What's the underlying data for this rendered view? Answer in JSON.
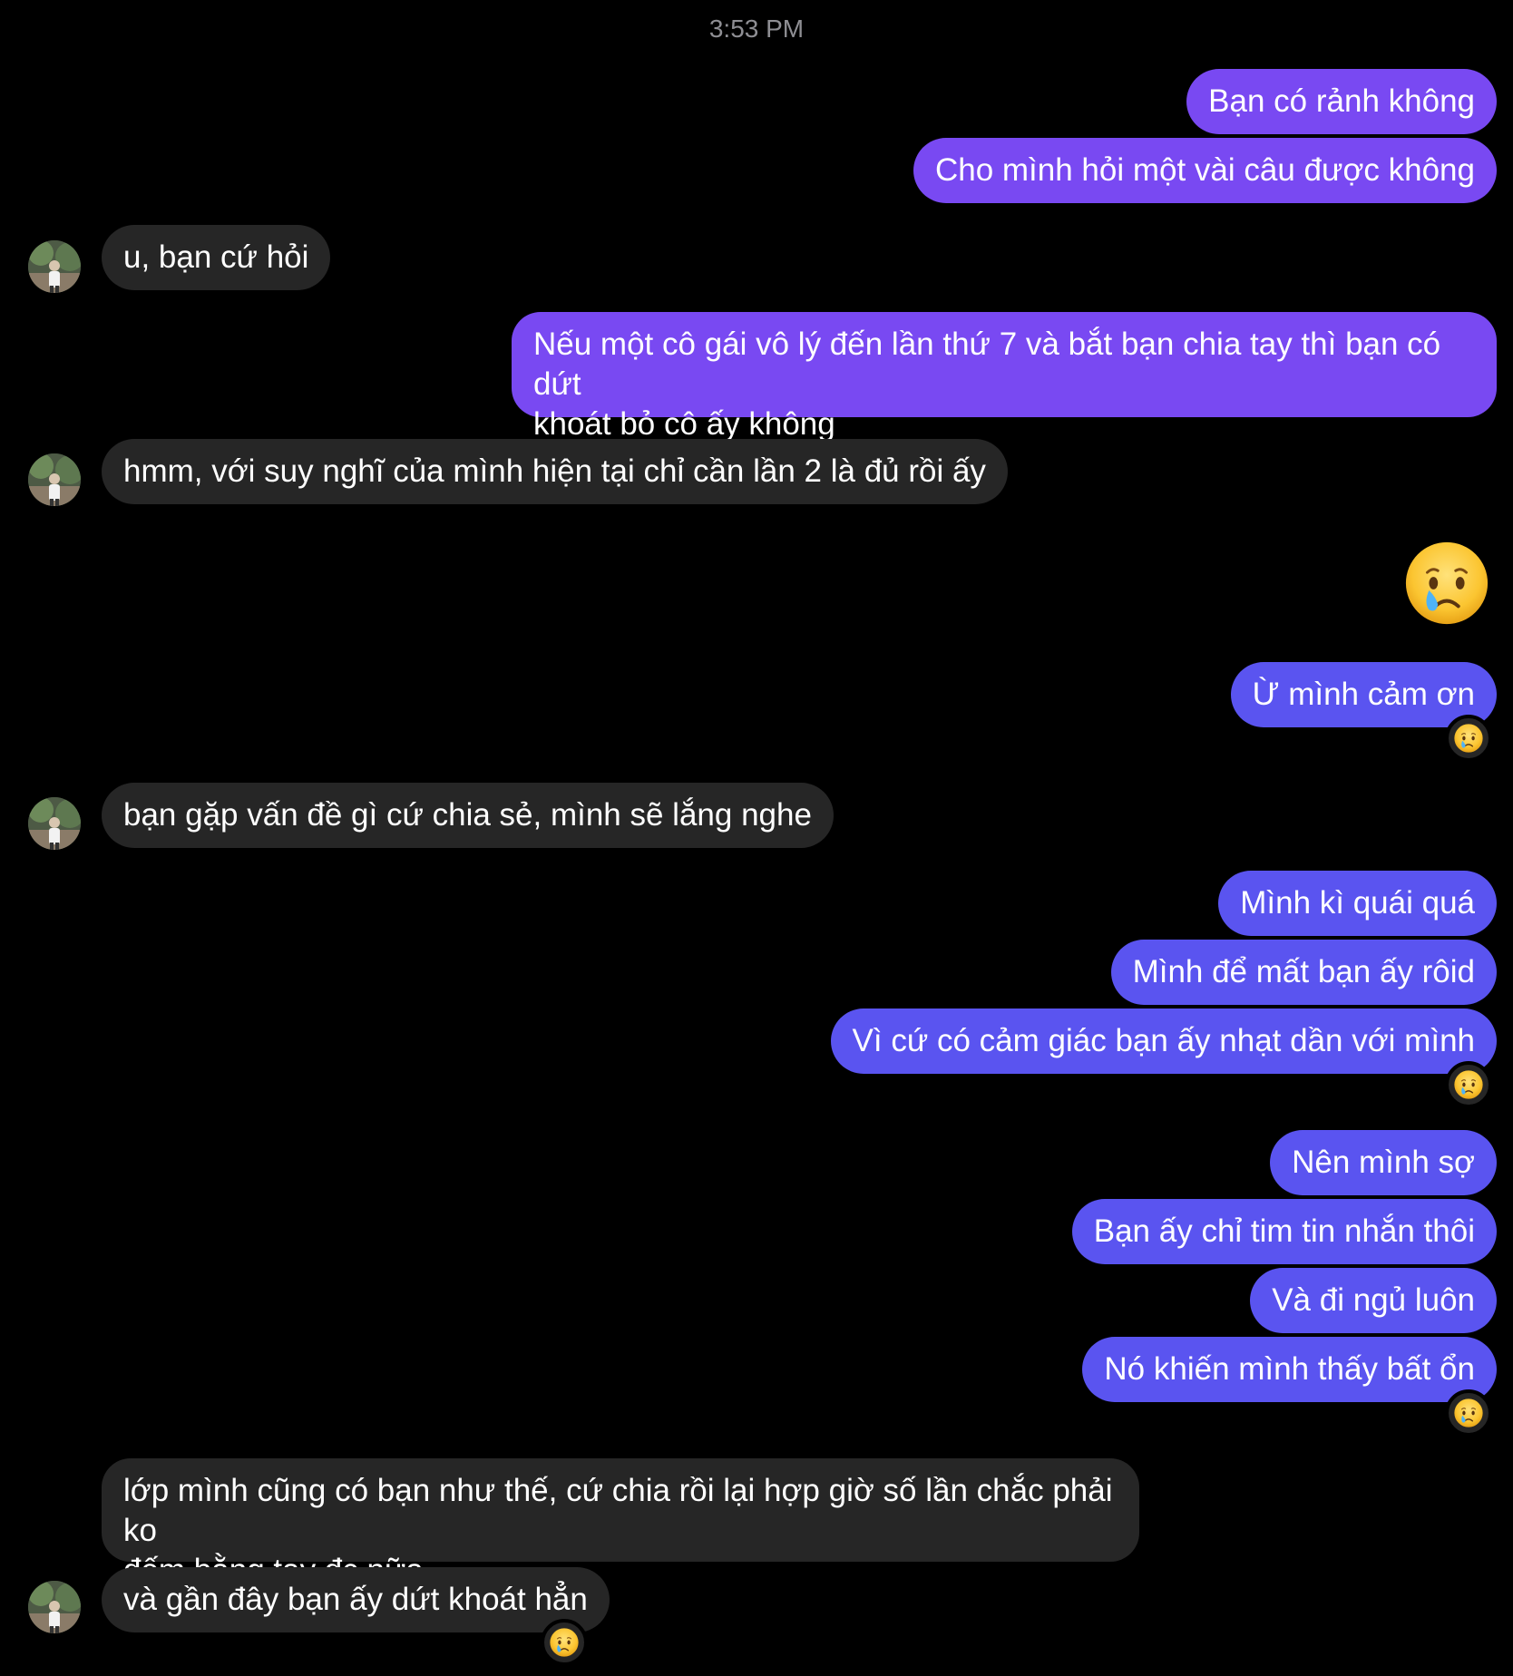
{
  "timestamp": "3:53 PM",
  "colors": {
    "background": "#000000",
    "incoming_bubble": "#262626",
    "outgoing_purple": "#7949f2",
    "outgoing_blue": "#5a54f0",
    "timestamp_text": "#8e8e93"
  },
  "messages": {
    "m1": "Bạn có rảnh không",
    "m2": "Cho mình hỏi một vài câu được không",
    "m3": "u, bạn cứ hỏi",
    "m4_line1": "Nếu một cô gái vô lý đến lần thứ 7 và bắt bạn chia tay thì bạn có dứt",
    "m4_line2": "khoát bỏ cô ấy không",
    "m5": "hmm, với suy nghĩ của mình hiện tại chỉ cần lần 2 là đủ rồi ấy",
    "m7": "Ừ mình cảm ơn",
    "m8": "bạn gặp vấn đề gì cứ chia sẻ, mình sẽ lắng nghe",
    "m9": "Mình kì quái quá",
    "m10": "Mình để mất bạn ấy rôid",
    "m11": "Vì cứ có cảm giác bạn ấy nhạt dần với mình",
    "m12": "Nên mình sợ",
    "m13": "Bạn ấy chỉ tim tin nhắn thôi",
    "m14": "Và đi ngủ luôn",
    "m15": "Nó khiến mình thấy bất ổn",
    "m16_line1": "lớp mình cũng có bạn như thế, cứ chia rồi lại hợp giờ số lần chắc phải ko",
    "m16_line2": "đếm bằng tay đc nữa",
    "m17": "và gần đây bạn ấy dứt khoát hẳn"
  },
  "icons": {
    "big_emoji": "crying-face",
    "reaction": "crying-face",
    "avatar": "contact-avatar"
  }
}
